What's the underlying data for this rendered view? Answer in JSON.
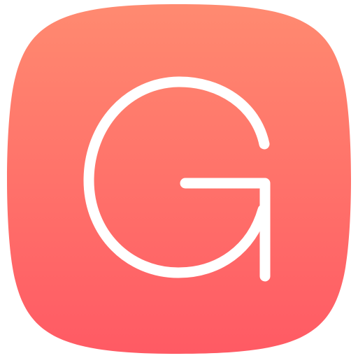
{
  "app_icon": {
    "icon_name": "g-letter-icon",
    "letter": "G",
    "colors": {
      "gradient_top": "#FF8A70",
      "gradient_bottom": "#FF5A64",
      "glyph": "#FFFFFF"
    }
  }
}
